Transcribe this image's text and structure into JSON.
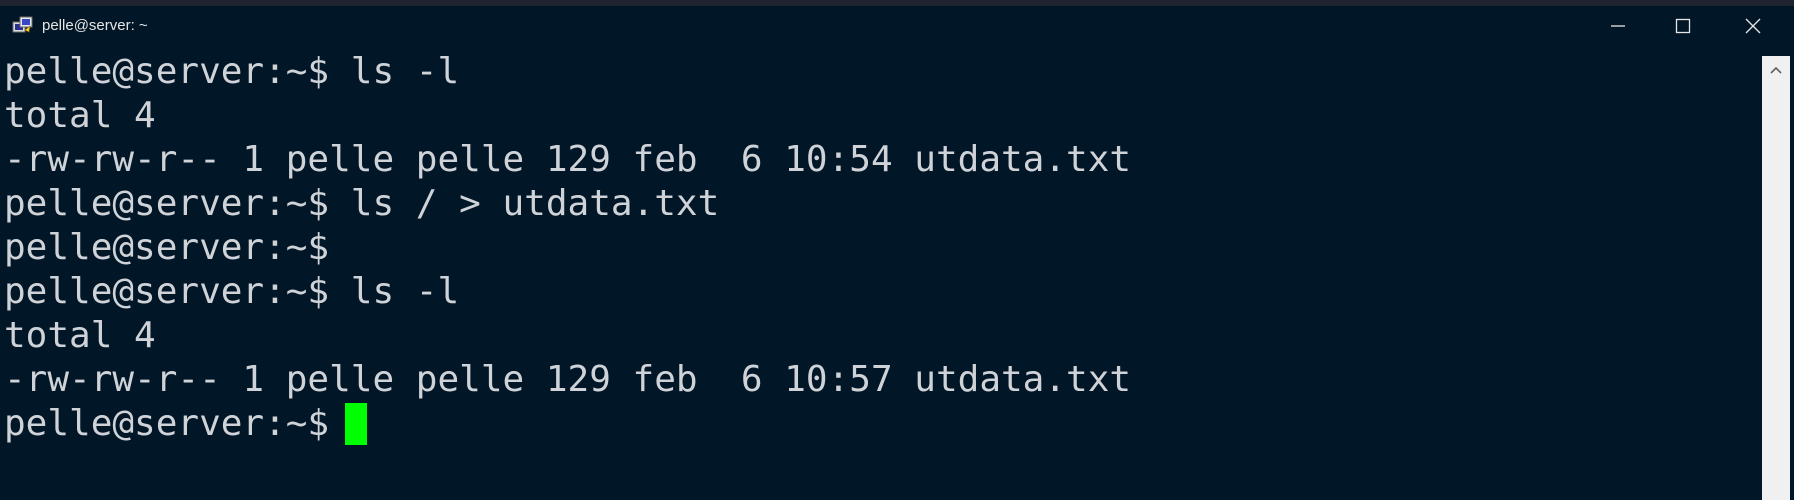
{
  "window": {
    "title": "pelle@server: ~",
    "icons": {
      "app": "putty-terminal-icon",
      "minimize": "minimize-icon",
      "maximize": "maximize-icon",
      "close": "close-icon",
      "scroll_up": "chevron-up-icon"
    }
  },
  "terminal": {
    "lines": [
      "pelle@server:~$ ls -l",
      "total 4",
      "-rw-rw-r-- 1 pelle pelle 129 feb  6 10:54 utdata.txt",
      "pelle@server:~$ ls / > utdata.txt",
      "pelle@server:~$",
      "pelle@server:~$ ls -l",
      "total 4",
      "-rw-rw-r-- 1 pelle pelle 129 feb  6 10:57 utdata.txt",
      "pelle@server:~$"
    ],
    "colors": {
      "background": "#011627",
      "foreground": "#cfd3d8",
      "cursor": "#00ff00"
    }
  }
}
